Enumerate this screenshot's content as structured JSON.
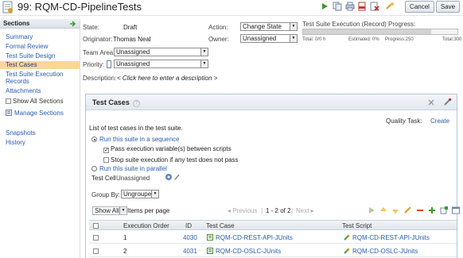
{
  "header": {
    "number": "99",
    "title": "99: RQM-CD-PipelineTests",
    "cancel_label": "Cancel",
    "save_label": "Save"
  },
  "nav": {
    "heading": "Sections",
    "items": [
      {
        "label": "Summary"
      },
      {
        "label": "Formal Review"
      },
      {
        "label": "Test Suite Design"
      },
      {
        "label": "Test Cases"
      },
      {
        "label": "Test Suite Execution"
      },
      {
        "label": "Records"
      },
      {
        "label": "Attachments"
      }
    ],
    "show_all_label": "Show All Sections",
    "manage_label": "Manage Sections",
    "links2": [
      {
        "label": "Snapshots"
      },
      {
        "label": "History"
      }
    ]
  },
  "form": {
    "state_label": "State:",
    "state_value": "Draft",
    "originator_label": "Originator:",
    "originator_value": "Thomas Neal",
    "team_area_label": "Team Area:",
    "team_area_value": "Unassigned",
    "priority_label": "Priority:",
    "priority_value": "Unassigned",
    "description_label": "Description:",
    "description_value": "< Click here to enter a description >",
    "action_label": "Action:",
    "action_value": "Change State",
    "owner_label": "Owner:",
    "owner_value": "Unassigned"
  },
  "progress": {
    "title": "Test Suite Execution (Record) Progress:",
    "total_label": "Total: 0/0 h",
    "estimated_label": "Estimated: 0%",
    "progress_label": "Progress:250",
    "total_count_label": "Total:300",
    "fraction": 0.83
  },
  "test_cases": {
    "title": "Test Cases",
    "help": "?",
    "intro": "List of test cases in the test suite.",
    "quality_task_label": "Quality Task:",
    "create_label": "Create",
    "run_sequence_label": "Run this suite in a sequence",
    "pass_vars_label": "Pass execution variable(s) between scripts",
    "stop_label": "Stop suite execution if any test does not pass",
    "run_parallel_label": "Run this suite in parallel",
    "test_cell_label": "Test Cell",
    "test_cell_value": "Unassigned",
    "group_by_label": "Group By:",
    "group_by_value": "Ungrouped",
    "show_all_value": "Show All",
    "items_per_page": "Items per page",
    "prev_label": "Previous",
    "pager_text": "1 - 2 of 2",
    "next_label": "Next",
    "columns": [
      "Execution Order",
      "ID",
      "Test Case",
      "Test Script"
    ],
    "rows": [
      {
        "order": "1",
        "id": "4030",
        "test_case": "RQM-CD-REST-API-JUnits",
        "test_script": "RQM-CD-REST-API-JUnits"
      },
      {
        "order": "2",
        "id": "4031",
        "test_case": "RQM-CD-OSLC-JUnits",
        "test_script": "RQM-CD-OSLC-JUnits"
      }
    ]
  },
  "colors": {
    "accent": "#2a5db0",
    "active_nav": "#fbd69a",
    "panel_border": "#b7c5d6"
  }
}
